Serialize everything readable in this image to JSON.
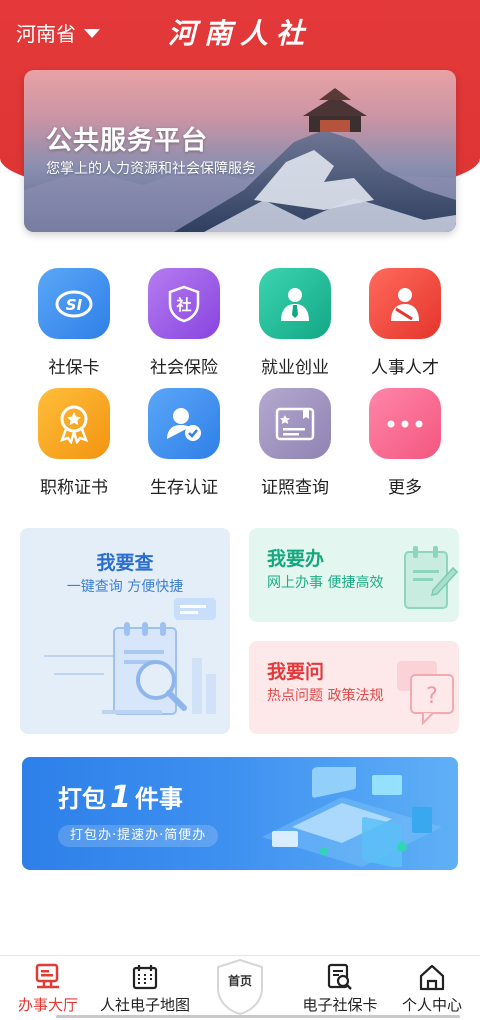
{
  "header": {
    "region": "河南省",
    "title": "河南人社"
  },
  "banner": {
    "title": "公共服务平台",
    "subtitle": "您掌上的人力资源和社会保障服务"
  },
  "grid": [
    {
      "label": "社保卡",
      "icon": "social-security-card-icon",
      "color": "#3d8ef0"
    },
    {
      "label": "社会保险",
      "icon": "shield-she-icon",
      "color": "#9b5ae8"
    },
    {
      "label": "就业创业",
      "icon": "business-person-icon",
      "color": "#1fbf9a"
    },
    {
      "label": "人事人才",
      "icon": "talent-person-icon",
      "color": "#f0473d"
    },
    {
      "label": "职称证书",
      "icon": "medal-icon",
      "color": "#f7a11c"
    },
    {
      "label": "生存认证",
      "icon": "user-verify-icon",
      "color": "#3d8ef0"
    },
    {
      "label": "证照查询",
      "icon": "certificate-icon",
      "color": "#9a8fbb"
    },
    {
      "label": "更多",
      "icon": "more-dots-icon",
      "color": "#f7628a"
    }
  ],
  "cards": {
    "query": {
      "title": "我要查",
      "subtitle": "一键查询  方便快捷"
    },
    "handle": {
      "title": "我要办",
      "subtitle": "网上办事  便捷高效"
    },
    "ask": {
      "title": "我要问",
      "subtitle": "热点问题  政策法规"
    }
  },
  "promo": {
    "title_pre": "打包",
    "title_num": "1",
    "title_post": "件事",
    "subtitle": "打包办·提速办·简便办"
  },
  "nav": {
    "items": [
      {
        "label": "办事大厅",
        "icon": "service-hall-icon"
      },
      {
        "label": "人社电子地图",
        "icon": "calendar-map-icon"
      },
      {
        "label": "电子社保卡",
        "icon": "e-card-search-icon"
      },
      {
        "label": "个人中心",
        "icon": "home-person-icon"
      }
    ],
    "home_label": "首页"
  },
  "colors": {
    "accent": "#e4393a",
    "query_card": "#e3eefa",
    "handle_card": "#e3f6f0",
    "ask_card": "#fde9ea",
    "promo": "#2d80e8"
  }
}
